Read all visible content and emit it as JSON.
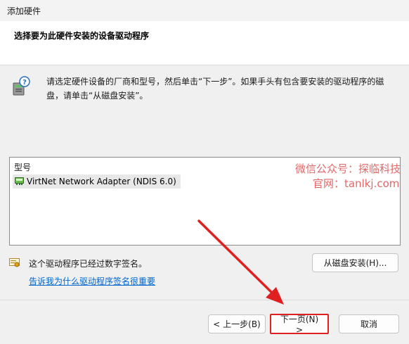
{
  "window": {
    "title": "添加硬件"
  },
  "header": {
    "title": "选择要为此硬件安装的设备驱动程序"
  },
  "instruction": "请选定硬件设备的厂商和型号，然后单击“下一步”。如果手头有包含要安装的驱动程序的磁盘，请单击“从磁盘安装”。",
  "model_list": {
    "column_header": "型号",
    "items": [
      {
        "label": "VirtNet Network Adapter (NDIS 6.0)",
        "icon": "network-adapter-icon"
      }
    ]
  },
  "watermark": {
    "line1": "微信公众号：探临科技",
    "line2": "官网：tanlkj.com"
  },
  "signature": {
    "status": "这个驱动程序已经过数字签名。",
    "icon": "certificate-icon"
  },
  "links": {
    "why_signing": "告诉我为什么驱动程序签名很重要"
  },
  "buttons": {
    "have_disk": "从磁盘安装(H)...",
    "back": "< 上一步(B)",
    "next": "下一页(N) >",
    "cancel": "取消"
  },
  "colors": {
    "highlight": "#e02020",
    "link": "#0066cc"
  }
}
